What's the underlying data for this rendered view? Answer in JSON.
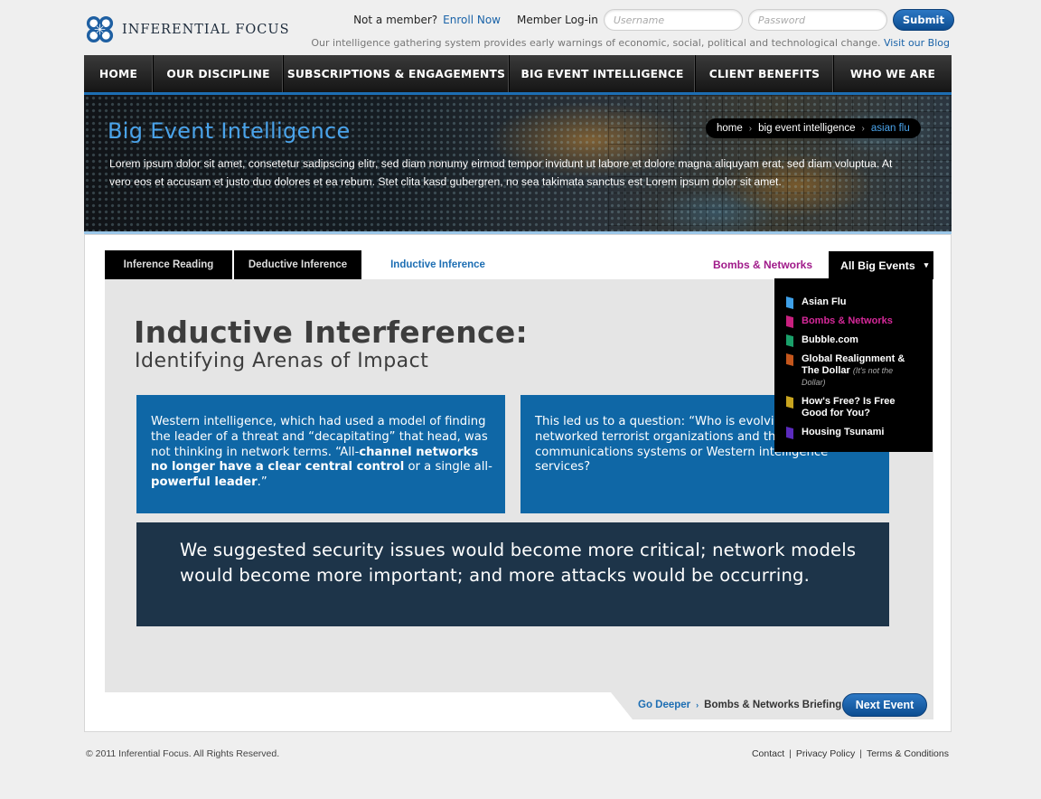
{
  "header": {
    "logo_text": "INFERENTIAL FOCUS",
    "not_member": "Not a member?",
    "enroll": "Enroll Now",
    "member_login": "Member Log-in",
    "username_placeholder": "Username",
    "password_placeholder": "Password",
    "submit": "Submit",
    "tagline": "Our intelligence gathering system provides early warnings of economic, social, political and technological change.",
    "blog_link": "Visit our Blog"
  },
  "nav": {
    "items": [
      "HOME",
      "OUR DISCIPLINE",
      "SUBSCRIPTIONS & ENGAGEMENTS",
      "BIG EVENT INTELLIGENCE",
      "CLIENT BENEFITS",
      "WHO WE ARE"
    ]
  },
  "hero": {
    "title": "Big Event Intelligence",
    "text": "Lorem ipsum dolor sit amet, consetetur sadipscing elitr, sed diam nonumy eirmod tempor invidunt ut labore et dolore magna aliquyam erat, sed diam voluptua. At vero eos et accusam et justo duo dolores et ea rebum. Stet clita kasd gubergren, no sea takimata sanctus est Lorem ipsum dolor sit amet.",
    "breadcrumb": [
      "home",
      "big event intelligence",
      "asian flu"
    ]
  },
  "tabs": {
    "items": [
      "Inference Reading",
      "Deductive Inference",
      "Inductive Inference"
    ],
    "bombs_link": "Bombs & Networks",
    "all_events": "All Big Events"
  },
  "content": {
    "title": "Inductive Interference:",
    "subtitle": "Identifying Arenas of Impact",
    "box1": {
      "p1": "Western intelligence, which had used a model of finding the leader of a threat and “decapitating” that head, was not thinking in network terms. “All-",
      "b1": "channel networks no longer have a clear central control",
      "p2": " or a single all-",
      "b2": "powerful leader",
      "p3": ".”"
    },
    "box2": "This led us to a question: “Who is evolving better networked terrorist organizations and their communications systems or Western intelligence services?",
    "quote": "We suggested security issues would become more critical; network models would become more important; and more attacks would be occurring."
  },
  "dropdown": {
    "items": [
      {
        "label": "Asian Flu",
        "color": "#3fa0e8"
      },
      {
        "label": "Bombs & Networks",
        "color": "#c9207f"
      },
      {
        "label": "Bubble.com",
        "color": "#1aa06a"
      },
      {
        "label": "Global Realignment & The Dollar",
        "note": "(It's not the Dollar)",
        "color": "#c4561c"
      },
      {
        "label": "How's Free? Is Free Good for You?",
        "color": "#c8a41f"
      },
      {
        "label": "Housing Tsunami",
        "color": "#5b2bbd"
      }
    ]
  },
  "bottom": {
    "go_deeper": "Go Deeper",
    "briefing": "Bombs & Networks Briefing",
    "next_event": "Next Event"
  },
  "footer": {
    "copyright": "© 2011 Inferential Focus. All Rights Reserved.",
    "links": [
      "Contact",
      "Privacy Policy",
      "Terms & Conditions"
    ]
  }
}
